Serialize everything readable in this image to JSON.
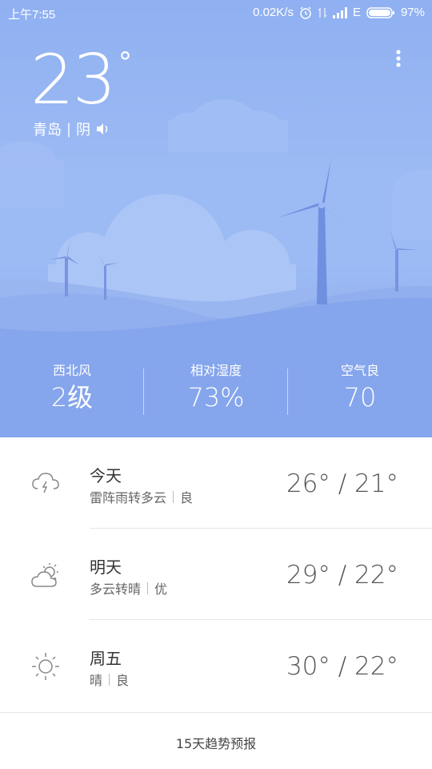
{
  "status_bar": {
    "time": "上午7:55",
    "speed": "0.02K/s",
    "network": "E",
    "battery": "97%"
  },
  "current": {
    "temperature": "23",
    "degree_symbol": "°",
    "city": "青岛",
    "separator": "|",
    "condition": "阴"
  },
  "stats": [
    {
      "label": "西北风",
      "value": "2级"
    },
    {
      "label": "相对湿度",
      "value": "73%"
    },
    {
      "label": "空气良",
      "value": "70"
    }
  ],
  "forecast": [
    {
      "day": "今天",
      "weather": "雷阵雨转多云",
      "air": "良",
      "temp": "26° / 21°",
      "icon": "thunderstorm-icon"
    },
    {
      "day": "明天",
      "weather": "多云转晴",
      "air": "优",
      "temp": "29° / 22°",
      "icon": "partly-cloudy-icon"
    },
    {
      "day": "周五",
      "weather": "晴",
      "air": "良",
      "temp": "30° / 22°",
      "icon": "sun-icon"
    }
  ],
  "trend_link": "15天趋势预报",
  "colors": {
    "sky_top": "#8fb0f2",
    "hill_light": "#a6c0f6",
    "hill_dark": "#7f9fe8",
    "turbine": "#6f8fdf"
  }
}
